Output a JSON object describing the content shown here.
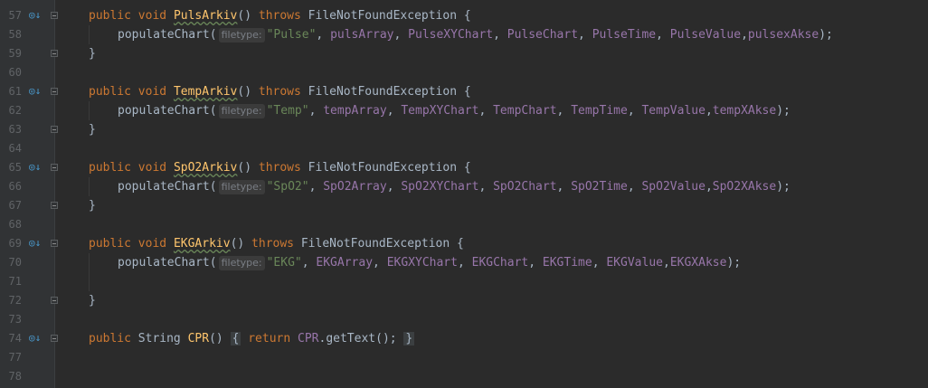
{
  "lines": [
    {
      "num": "57",
      "marker": true,
      "code": {
        "kw1": "public",
        "kw2": "void",
        "name": "PulsArkiv",
        "rest": "() ",
        "throws": "throws",
        "exc": " FileNotFoundException {"
      }
    },
    {
      "num": "58",
      "call": {
        "method": "populateChart(",
        "hint": "filetype:",
        "str": "\"Pulse\"",
        "args": [
          ", ",
          "pulsArray",
          ", ",
          "PulseXYChart",
          ", ",
          "PulseChart",
          ", ",
          "PulseTime",
          ", ",
          "PulseValue",
          ",",
          "pulsexAkse"
        ],
        "end": ");"
      }
    },
    {
      "num": "59",
      "close": "}"
    },
    {
      "num": "60"
    },
    {
      "num": "61",
      "marker": true,
      "code": {
        "kw1": "public",
        "kw2": "void",
        "name": "TempArkiv",
        "rest": "() ",
        "throws": "throws",
        "exc": " FileNotFoundException {"
      }
    },
    {
      "num": "62",
      "call": {
        "method": "populateChart(",
        "hint": "filetype:",
        "str": "\"Temp\"",
        "args": [
          ", ",
          "tempArray",
          ", ",
          "TempXYChart",
          ", ",
          "TempChart",
          ", ",
          "TempTime",
          ", ",
          "TempValue",
          ",",
          "tempXAkse"
        ],
        "end": ");"
      }
    },
    {
      "num": "63",
      "close": "}"
    },
    {
      "num": "64"
    },
    {
      "num": "65",
      "marker": true,
      "code": {
        "kw1": "public",
        "kw2": "void",
        "name": "SpO2Arkiv",
        "rest": "() ",
        "throws": "throws",
        "exc": " FileNotFoundException {"
      }
    },
    {
      "num": "66",
      "call": {
        "method": "populateChart(",
        "hint": "filetype:",
        "str": "\"SpO2\"",
        "args": [
          ", ",
          "SpO2Array",
          ", ",
          "SpO2XYChart",
          ", ",
          "SpO2Chart",
          ", ",
          "SpO2Time",
          ", ",
          "SpO2Value",
          ",",
          "SpO2XAkse"
        ],
        "end": ");"
      }
    },
    {
      "num": "67",
      "close": "}"
    },
    {
      "num": "68"
    },
    {
      "num": "69",
      "marker": true,
      "code": {
        "kw1": "public",
        "kw2": "void",
        "name": "EKGArkiv",
        "rest": "() ",
        "throws": "throws",
        "exc": " FileNotFoundException {"
      }
    },
    {
      "num": "70",
      "call": {
        "method": "populateChart(",
        "hint": "filetype:",
        "str": "\"EKG\"",
        "args": [
          ", ",
          "EKGArray",
          ", ",
          "EKGXYChart",
          ", ",
          "EKGChart",
          ", ",
          "EKGTime",
          ", ",
          "EKGValue",
          ",",
          "EKGXAkse"
        ],
        "end": ");"
      }
    },
    {
      "num": "71"
    },
    {
      "num": "72",
      "close": "}"
    },
    {
      "num": "73"
    },
    {
      "num": "74",
      "marker": true,
      "cpr": {
        "kw1": "public",
        "type": "String",
        "name": "CPR",
        "parens": "()",
        "open": "{",
        "ret": "return",
        "field": "CPR",
        "call": ".getText();",
        "close": "}"
      }
    },
    {
      "num": "77"
    },
    {
      "num": "78"
    }
  ],
  "icons": {
    "gutter_marker": "implementing-method-icon",
    "fold": "fold-toggle-icon"
  },
  "colors": {
    "background": "#2b2b2b",
    "keyword": "#cc7832",
    "string": "#6a8759",
    "field": "#9876aa",
    "method": "#ffc66d",
    "text": "#a9b7c6"
  }
}
